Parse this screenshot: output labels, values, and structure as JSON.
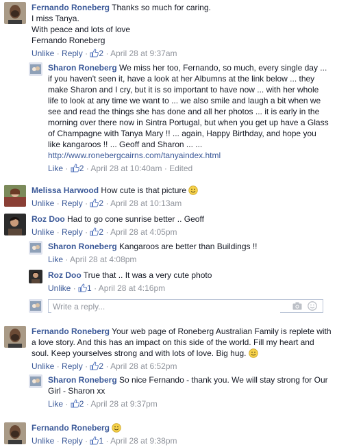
{
  "actions": {
    "like": "Like",
    "unlike": "Unlike",
    "reply": "Reply",
    "edited": "Edited",
    "sep": "·"
  },
  "colors": {
    "link": "#3b5998",
    "meta": "#90949c",
    "text": "#141823"
  },
  "comments": [
    {
      "author": "Fernando Roneberg",
      "text": "Thanks so much for caring.\nI miss Tanya.\nWith peace and lots of love\nFernando Roneberg",
      "likes": "2",
      "time": "April 28 at 9:37am"
    },
    {
      "author": "Sharon Roneberg",
      "text": "We miss her too, Fernando, so much, every single day ... if you haven't seen it, have a look at her Albumns at the link below ... they make Sharon and I cry, but it is so important to have now ... with her whole life to look at any time we want to ... we also smile and laugh a bit when we see and read the things she has done and all her photos ... it is early in the morning over there now in Sintra Portugal, but when you get up have a Glass of Champagne with Tanya Mary !! ... again, Happy Birthday, and hope you like kangaroos !! ... Geoff and Sharon ... ...",
      "link": "http://www.ronebergcairns.com/tanyaindex.html",
      "likes": "2",
      "time": "April 28 at 10:40am"
    },
    {
      "author": "Melissa Harwood",
      "text": "How cute is that picture",
      "likes": "2",
      "time": "April 28 at 10:13am"
    },
    {
      "author": "Roz Doo",
      "text": "Had to go cone sunrise better .. Geoff",
      "likes": "2",
      "time": "April 28 at 4:05pm"
    },
    {
      "author": "Sharon Roneberg",
      "text": "Kangaroos are better than Buildings !!",
      "time": "April 28 at 4:08pm"
    },
    {
      "author": "Roz Doo",
      "text": "True that .. It was a very cute photo",
      "likes": "1",
      "time": "April 28 at 4:16pm"
    },
    {
      "author": "Fernando Roneberg",
      "text": "Your web page of Roneberg Australian Family is replete with a love story. And this has an impact on this side of the world. Fill my heart and soul. Keep yourselves strong and with lots of love. Big hug.",
      "likes": "2",
      "time": "April 28 at 6:52pm"
    },
    {
      "author": "Sharon Roneberg",
      "text": "So nice Fernando - thank you. We will stay strong for Our Girl - Sharon xx",
      "likes": "2",
      "time": "April 28 at 9:37pm"
    },
    {
      "author": "Fernando Roneberg",
      "text": "",
      "likes": "1",
      "time": "April 28 at 9:38pm"
    }
  ],
  "reply_box": {
    "placeholder": "Write a reply..."
  }
}
